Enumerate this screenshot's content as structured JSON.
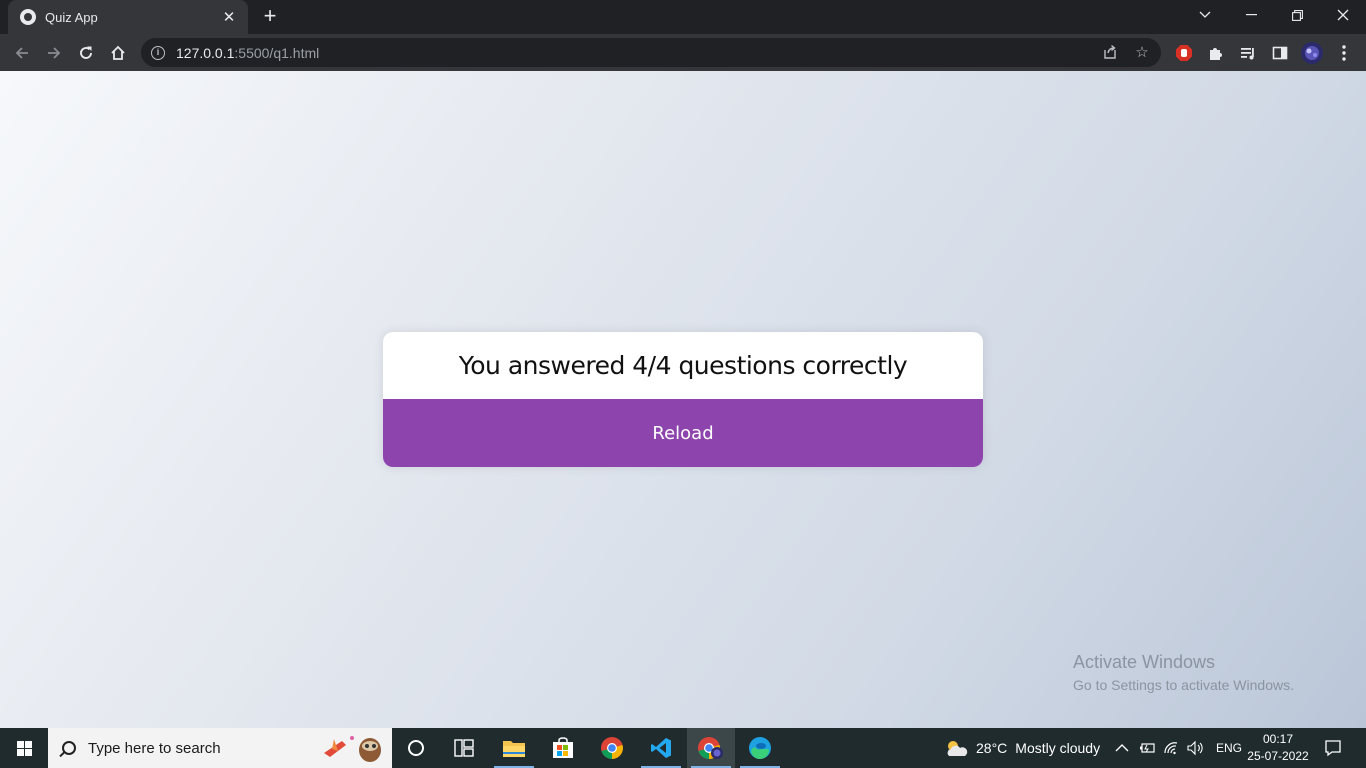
{
  "browser": {
    "tab_title": "Quiz App",
    "tab_close": "✕",
    "new_tab": "+",
    "url_host": "127.0.0.1",
    "url_path": ":5500/q1.html",
    "window_controls": {
      "chevron": "⌄",
      "minimize": "—",
      "restore": "❐",
      "close": "✕"
    }
  },
  "quiz": {
    "result_text": "You answered 4/4 questions correctly",
    "reload_label": "Reload",
    "accent_color": "#8e44ad"
  },
  "watermark": {
    "title": "Activate Windows",
    "subtitle": "Go to Settings to activate Windows."
  },
  "taskbar": {
    "search_placeholder": "Type here to search",
    "weather_temp": "28°C",
    "weather_text": "Mostly cloudy",
    "language": "ENG",
    "time": "00:17",
    "date": "25-07-2022"
  }
}
